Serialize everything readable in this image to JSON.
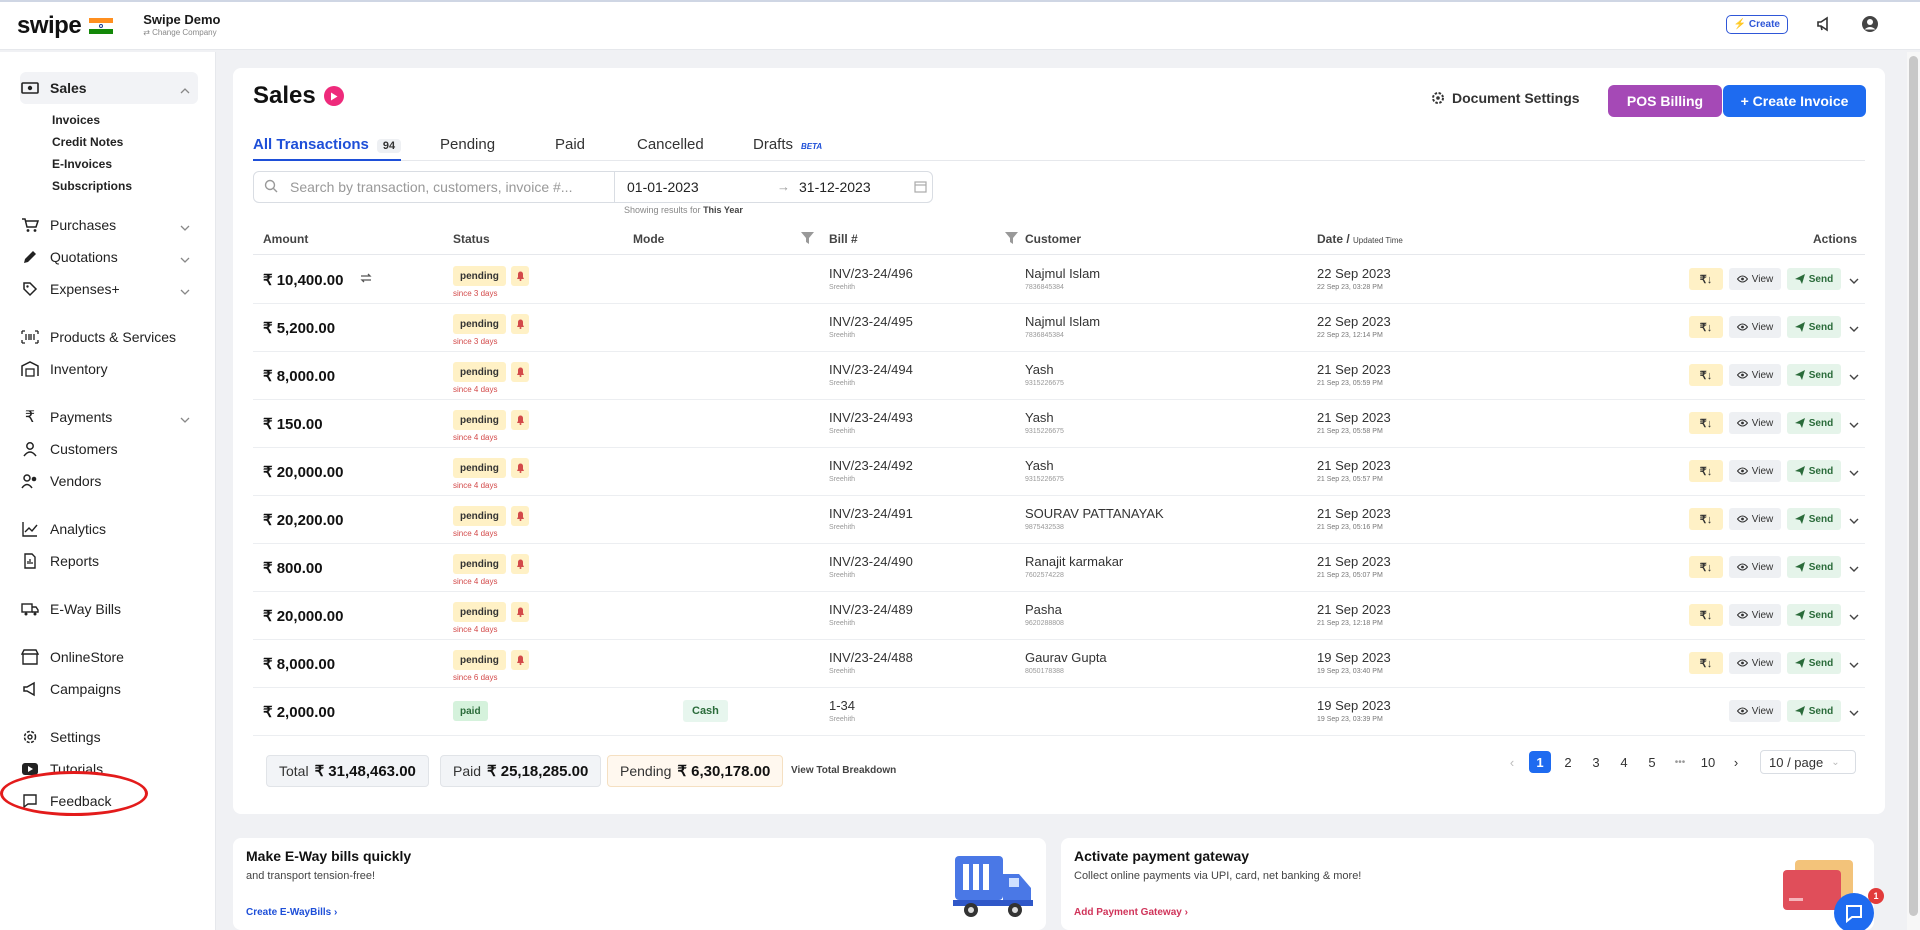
{
  "app": {
    "logo": "swipe",
    "company_name": "Swipe Demo",
    "change_company": "⇄ Change Company",
    "create_label": "⚡ Create"
  },
  "sidebar": {
    "sales": "Sales",
    "sub": [
      "Invoices",
      "Credit Notes",
      "E-Invoices",
      "Subscriptions"
    ],
    "items": [
      "Purchases",
      "Quotations",
      "Expenses+",
      "Products & Services",
      "Inventory",
      "Payments",
      "Customers",
      "Vendors",
      "Analytics",
      "Reports",
      "E-Way Bills",
      "OnlineStore",
      "Campaigns",
      "Settings",
      "Tutorials",
      "Feedback"
    ]
  },
  "header": {
    "title": "Sales",
    "doc_settings": "Document Settings",
    "pos_billing": "POS Billing",
    "create_invoice": "+ Create Invoice"
  },
  "tabs": {
    "all": "All Transactions",
    "all_count": "94",
    "pending": "Pending",
    "paid": "Paid",
    "cancelled": "Cancelled",
    "drafts": "Drafts",
    "beta": "BETA"
  },
  "filters": {
    "search_placeholder": "Search by transaction, customers, invoice #...",
    "date_from": "01-01-2023",
    "date_to": "31-12-2023",
    "showing_prefix": "Showing results for",
    "showing_period": "This Year"
  },
  "columns": {
    "amount": "Amount",
    "status": "Status",
    "mode": "Mode",
    "bill": "Bill #",
    "customer": "Customer",
    "date": "Date /",
    "date_sub": "Updated Time",
    "actions": "Actions"
  },
  "rows": [
    {
      "amount": "₹ 10,400.00",
      "status": "pending",
      "since": "since 3 days",
      "mode": "",
      "bill": "INV/23-24/496",
      "bill_by": "Sreehith",
      "customer": "Najmul Islam",
      "phone": "7836845384",
      "date": "22 Sep 2023",
      "time": "22 Sep 23, 03:28 PM"
    },
    {
      "amount": "₹ 5,200.00",
      "status": "pending",
      "since": "since 3 days",
      "mode": "",
      "bill": "INV/23-24/495",
      "bill_by": "Sreehith",
      "customer": "Najmul Islam",
      "phone": "7836845384",
      "date": "22 Sep 2023",
      "time": "22 Sep 23, 12:14 PM"
    },
    {
      "amount": "₹ 8,000.00",
      "status": "pending",
      "since": "since 4 days",
      "mode": "",
      "bill": "INV/23-24/494",
      "bill_by": "Sreehith",
      "customer": "Yash",
      "phone": "9315226675",
      "date": "21 Sep 2023",
      "time": "21 Sep 23, 05:59 PM"
    },
    {
      "amount": "₹ 150.00",
      "status": "pending",
      "since": "since 4 days",
      "mode": "",
      "bill": "INV/23-24/493",
      "bill_by": "Sreehith",
      "customer": "Yash",
      "phone": "9315226675",
      "date": "21 Sep 2023",
      "time": "21 Sep 23, 05:58 PM"
    },
    {
      "amount": "₹ 20,000.00",
      "status": "pending",
      "since": "since 4 days",
      "mode": "",
      "bill": "INV/23-24/492",
      "bill_by": "Sreehith",
      "customer": "Yash",
      "phone": "9315226675",
      "date": "21 Sep 2023",
      "time": "21 Sep 23, 05:57 PM"
    },
    {
      "amount": "₹ 20,200.00",
      "status": "pending",
      "since": "since 4 days",
      "mode": "",
      "bill": "INV/23-24/491",
      "bill_by": "Sreehith",
      "customer": "SOURAV PATTANAYAK",
      "phone": "9875432538",
      "date": "21 Sep 2023",
      "time": "21 Sep 23, 05:16 PM"
    },
    {
      "amount": "₹ 800.00",
      "status": "pending",
      "since": "since 4 days",
      "mode": "",
      "bill": "INV/23-24/490",
      "bill_by": "Sreehith",
      "customer": "Ranajit karmakar",
      "phone": "7602574228",
      "date": "21 Sep 2023",
      "time": "21 Sep 23, 05:07 PM"
    },
    {
      "amount": "₹ 20,000.00",
      "status": "pending",
      "since": "since 4 days",
      "mode": "",
      "bill": "INV/23-24/489",
      "bill_by": "Sreehith",
      "customer": "Pasha",
      "phone": "9620288808",
      "date": "21 Sep 2023",
      "time": "21 Sep 23, 12:18 PM"
    },
    {
      "amount": "₹ 8,000.00",
      "status": "pending",
      "since": "since 6 days",
      "mode": "",
      "bill": "INV/23-24/488",
      "bill_by": "Sreehith",
      "customer": "Gaurav Gupta",
      "phone": "8050178388",
      "date": "19 Sep 2023",
      "time": "19 Sep 23, 03:40 PM"
    },
    {
      "amount": "₹ 2,000.00",
      "status": "paid",
      "since": "",
      "mode": "Cash",
      "bill": "1-34",
      "bill_by": "Sreehith",
      "customer": "",
      "phone": "",
      "date": "19 Sep 2023",
      "time": "19 Sep 23, 03:39 PM"
    }
  ],
  "actions": {
    "download": "₹↓",
    "view": "View",
    "send": "Send"
  },
  "totals": {
    "total_label": "Total",
    "total_value": "₹ 31,48,463.00",
    "paid_label": "Paid",
    "paid_value": "₹ 25,18,285.00",
    "pending_label": "Pending",
    "pending_value": "₹ 6,30,178.00",
    "breakdown": "View Total Breakdown"
  },
  "pagination": {
    "pages": [
      "1",
      "2",
      "3",
      "4",
      "5"
    ],
    "ellipsis": "•••",
    "last": "10",
    "per_page": "10 / page"
  },
  "cards": {
    "eway_title": "Make E-Way bills quickly",
    "eway_sub": "and transport tension-free!",
    "eway_link": "Create E-WayBills ›",
    "pay_title": "Activate payment gateway",
    "pay_sub": "Collect online payments via UPI, card, net banking & more!",
    "pay_link": "Add Payment Gateway ›"
  },
  "chat": {
    "badge": "1"
  },
  "colors": {
    "primary": "#1e6bf0",
    "pos": "#a549b6",
    "pending_bg": "#fff1c6",
    "paid_bg": "#d5f2dc",
    "highlight": "#e31b1b"
  }
}
